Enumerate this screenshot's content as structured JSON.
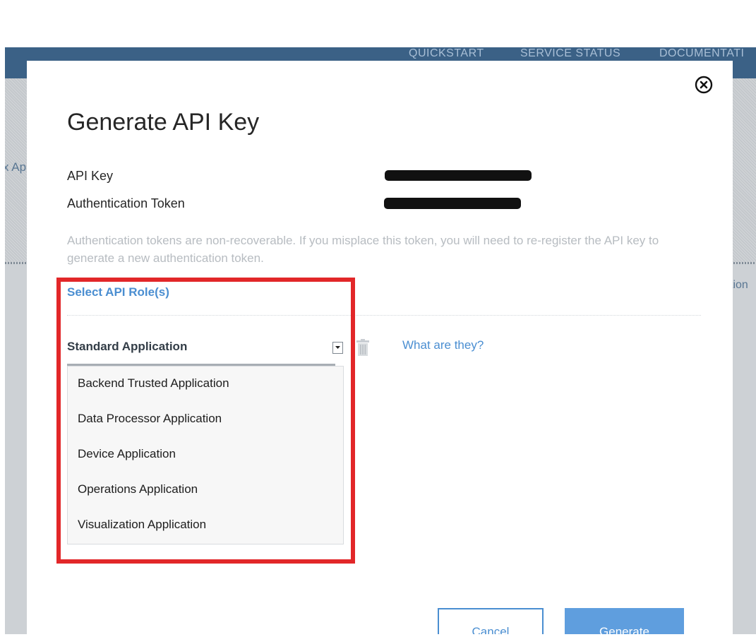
{
  "background_app": {
    "nav_items": [
      "QUICKSTART",
      "SERVICE STATUS",
      "DOCUMENTATI"
    ],
    "left_partial_text": "x Ap",
    "right_partial_text": "tion"
  },
  "modal": {
    "title": "Generate API Key",
    "close_icon": "close-circle-icon",
    "fields": [
      {
        "label": "API Key",
        "value_state": "redacted"
      },
      {
        "label": "Authentication Token",
        "value_state": "redacted"
      }
    ],
    "help_text": "Authentication tokens are non-recoverable. If you misplace this token, you will need to re-register the API key to generate a new authentication token.",
    "roles_section": {
      "title": "Select API Role(s)",
      "selected_value": "Standard Application",
      "help_link": "What are they?",
      "options": [
        "Backend Trusted Application",
        "Data Processor Application",
        "Device Application",
        "Operations Application",
        "Visualization Application"
      ]
    },
    "buttons": {
      "cancel": "Cancel",
      "generate": "Generate"
    }
  },
  "colors": {
    "accent": "#4a8ed1",
    "primary_button": "#5f9ede",
    "highlight": "#e22729",
    "nav_bar": "#3b6186"
  }
}
